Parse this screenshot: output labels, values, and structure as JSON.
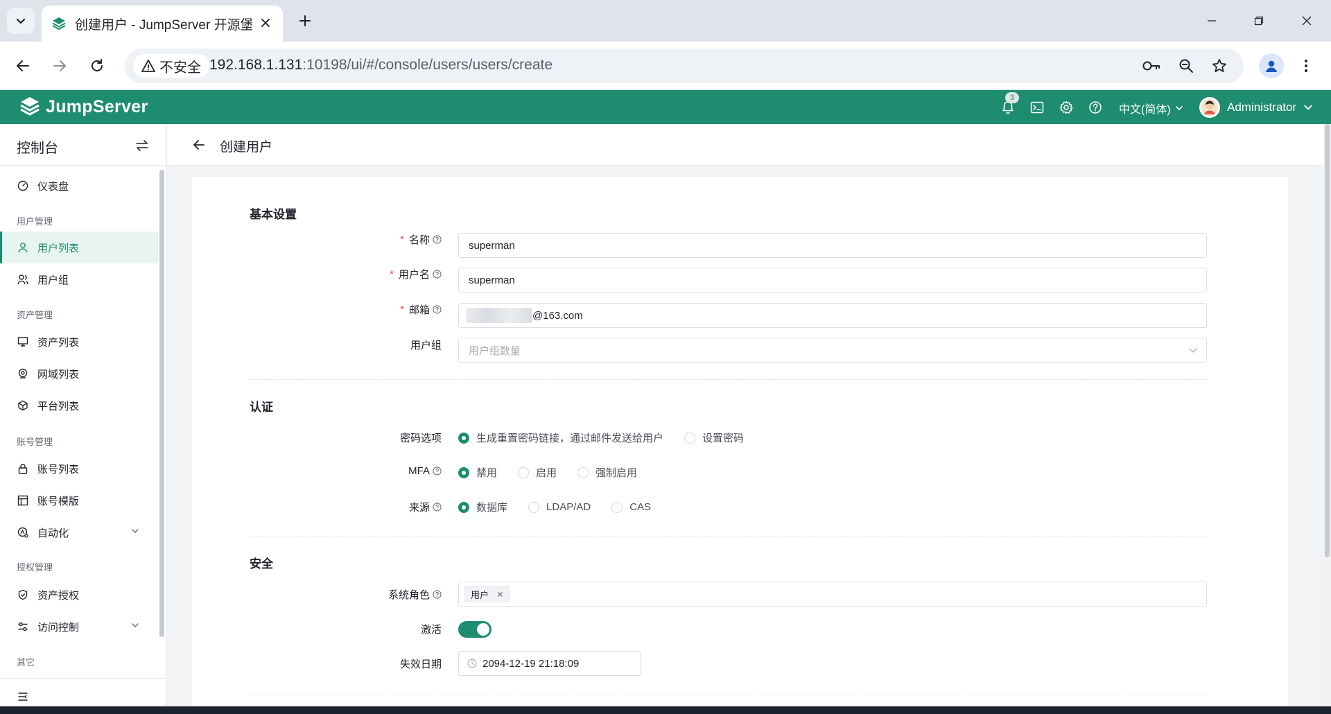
{
  "browser": {
    "tab_title": "创建用户 - JumpServer 开源堡垒机",
    "security_label": "不安全",
    "url_host": "192.168.1.131",
    "url_rest": ":10198/ui/#/console/users/users/create"
  },
  "header": {
    "logo_text": "JumpServer",
    "notification_count": "3",
    "language": "中文(简体)",
    "username": "Administrator"
  },
  "sidebar": {
    "title": "控制台",
    "dashboard": "仪表盘",
    "groups": {
      "users": "用户管理",
      "assets": "资产管理",
      "accounts": "账号管理",
      "perms": "授权管理",
      "other": "其它"
    },
    "items": {
      "user_list": "用户列表",
      "user_groups": "用户组",
      "asset_list": "资产列表",
      "zone_list": "网域列表",
      "platform_list": "平台列表",
      "account_list": "账号列表",
      "account_templates": "账号模版",
      "automation": "自动化",
      "asset_perms": "资产授权",
      "access_control": "访问控制"
    }
  },
  "page": {
    "title": "创建用户",
    "sections": {
      "basic": "基本设置",
      "auth": "认证",
      "security": "安全"
    },
    "fields": {
      "name_label": "名称",
      "name_value": "superman",
      "username_label": "用户名",
      "username_value": "superman",
      "email_label": "邮箱",
      "email_value": "@163.com",
      "group_label": "用户组",
      "group_placeholder": "用户组数量",
      "password_label": "密码选项",
      "password_opt1": "生成重置密码链接，通过邮件发送给用户",
      "password_opt2": "设置密码",
      "mfa_label": "MFA",
      "mfa_opt1": "禁用",
      "mfa_opt2": "启用",
      "mfa_opt3": "强制启用",
      "source_label": "来源",
      "source_opt1": "数据库",
      "source_opt2": "LDAP/AD",
      "source_opt3": "CAS",
      "role_label": "系统角色",
      "role_tag": "用户",
      "active_label": "激活",
      "expire_label": "失效日期",
      "expire_value": "2094-12-19 21:18:09"
    }
  },
  "colors": {
    "brand": "#1e8c6f"
  }
}
